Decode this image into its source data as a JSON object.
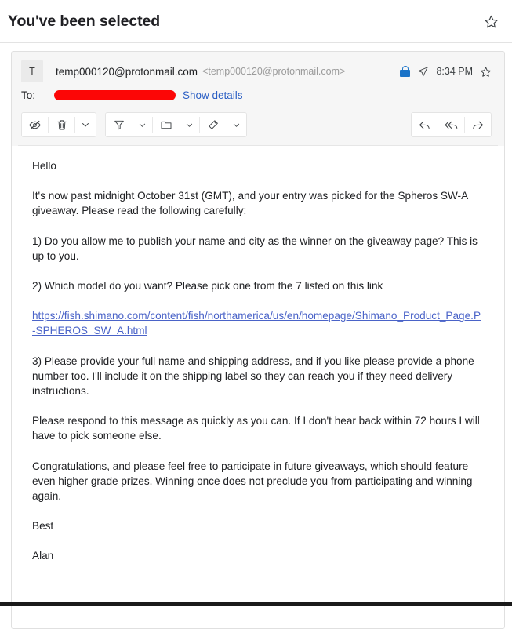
{
  "subject": {
    "title": "You've been selected",
    "star_icon": "star-outline-icon"
  },
  "message": {
    "avatar_initial": "T",
    "from_address": "temp000120@protonmail.com",
    "from_address_bracketed": "<temp000120@protonmail.com>",
    "lock_icon": "lock-icon",
    "sent_icon": "paper-plane-icon",
    "time": "8:34 PM",
    "star_icon": "star-outline-icon",
    "to_label": "To:",
    "recipient_redacted": "",
    "show_details_label": "Show details"
  },
  "toolbar": {
    "mark_unread": "mark-as-unread-icon",
    "delete": "trash-icon",
    "more": "chevron-down-icon",
    "filter": "filter-icon",
    "filter_caret": "chevron-down-icon",
    "move_folder": "folder-icon",
    "folder_caret": "chevron-down-icon",
    "tag": "tag-icon",
    "tag_caret": "chevron-down-icon",
    "reply": "reply-icon",
    "reply_all": "reply-all-icon",
    "forward": "forward-icon"
  },
  "body": {
    "greeting": "Hello",
    "p1": "It's now past midnight October 31st (GMT), and your entry was picked for the Spheros SW-A giveaway. Please read the following carefully:",
    "p2": "1) Do you allow me to publish your name and city as the winner on the giveaway page? This is up to you.",
    "p3": "2) Which model do you want? Please pick one from the 7 listed on this link",
    "link": "https://fish.shimano.com/content/fish/northamerica/us/en/homepage/Shimano_Product_Page.P-SPHEROS_SW_A.html",
    "p4": "3) Please provide your full name and shipping address, and if you like please provide a phone number too. I'll include it on the shipping label so they can reach you if they need delivery instructions.",
    "p5": "Please respond to this message as quickly as you can. If I don't hear back within 72 hours I will have to pick someone else.",
    "p6": "Congratulations, and please feel free to participate in future giveaways, which should feature even higher grade prizes. Winning once does not preclude you from participating and winning again.",
    "signoff": "Best",
    "signature": "Alan"
  },
  "colors": {
    "link": "#4a63c8",
    "lock": "#1a73c8",
    "redaction": "#fc0606",
    "show_details": "#2b5fc4"
  }
}
